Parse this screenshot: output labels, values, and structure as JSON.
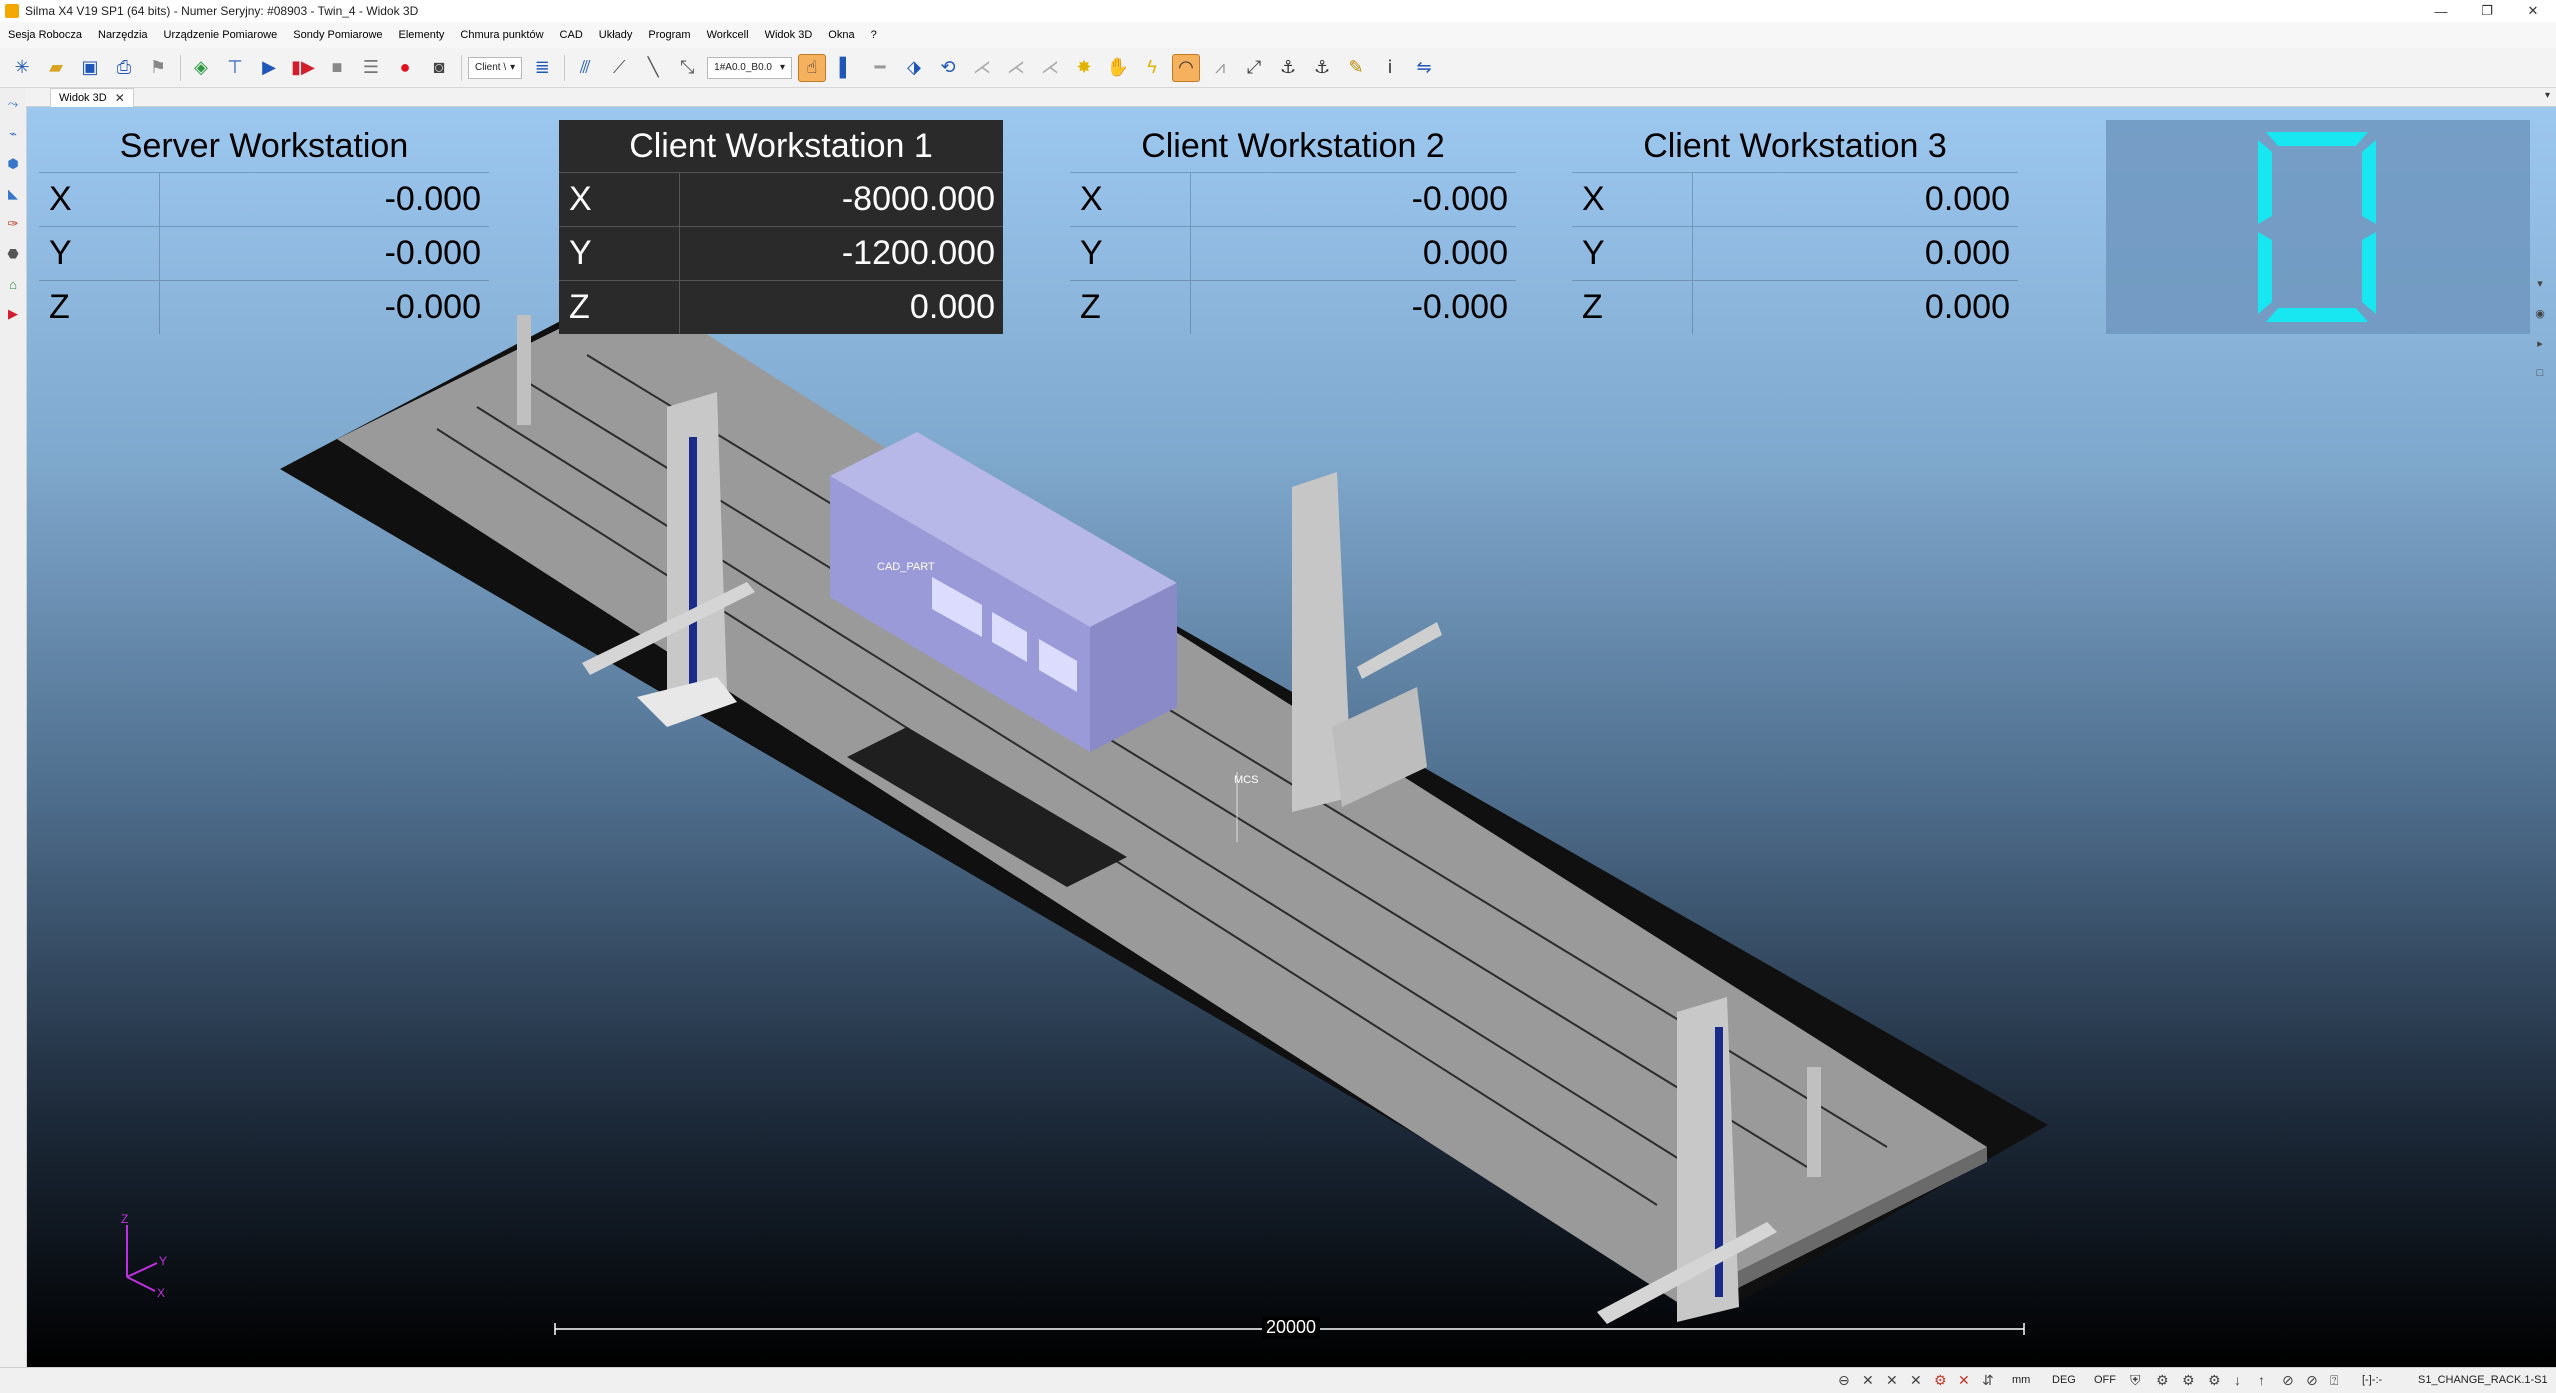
{
  "window": {
    "title": "Silma X4 V19 SP1 (64 bits) - Numer Seryjny: #08903 - Twin_4 - Widok 3D",
    "controls": [
      "—",
      "❐",
      "✕"
    ]
  },
  "menu": [
    "Sesja Robocza",
    "Narzędzia",
    "Urządzenie Pomiarowe",
    "Sondy Pomiarowe",
    "Elementy",
    "Chmura punktów",
    "CAD",
    "Układy",
    "Program",
    "Workcell",
    "Widok 3D",
    "Okna",
    "?"
  ],
  "toolbar": {
    "combo_client": "Client \\",
    "combo_probe": "1#A0.0_B0.0"
  },
  "tab": {
    "label": "Widok 3D",
    "close": "✕"
  },
  "dro": [
    {
      "title": "Server Workstation",
      "rows": [
        {
          "axis": "X",
          "value": "-0.000"
        },
        {
          "axis": "Y",
          "value": "-0.000"
        },
        {
          "axis": "Z",
          "value": "-0.000"
        }
      ]
    },
    {
      "title": "Client Workstation 1",
      "rows": [
        {
          "axis": "X",
          "value": "-8000.000"
        },
        {
          "axis": "Y",
          "value": "-1200.000"
        },
        {
          "axis": "Z",
          "value": "0.000"
        }
      ]
    },
    {
      "title": "Client Workstation 2",
      "rows": [
        {
          "axis": "X",
          "value": "-0.000"
        },
        {
          "axis": "Y",
          "value": "0.000"
        },
        {
          "axis": "Z",
          "value": "-0.000"
        }
      ]
    },
    {
      "title": "Client Workstation 3",
      "rows": [
        {
          "axis": "X",
          "value": "0.000"
        },
        {
          "axis": "Y",
          "value": "0.000"
        },
        {
          "axis": "Z",
          "value": "0.000"
        }
      ]
    }
  ],
  "counter": {
    "digit": "0",
    "color": "#18e6f0"
  },
  "scene": {
    "cad_label": "CAD_PART",
    "mcs_label": "MCS",
    "scale_label": "20000",
    "triad": {
      "z": "Z",
      "y": "Y",
      "x": "X",
      "color": "#c030e0"
    }
  },
  "status": {
    "unit": "mm",
    "angle": "DEG",
    "mode": "OFF",
    "coord": "[-]-:-",
    "program_step": "S1_CHANGE_RACK.1-S1"
  },
  "colors": {
    "viewport_top": "#9cc7ef",
    "viewport_bottom": "#000000",
    "accent": "#f6b15f"
  }
}
